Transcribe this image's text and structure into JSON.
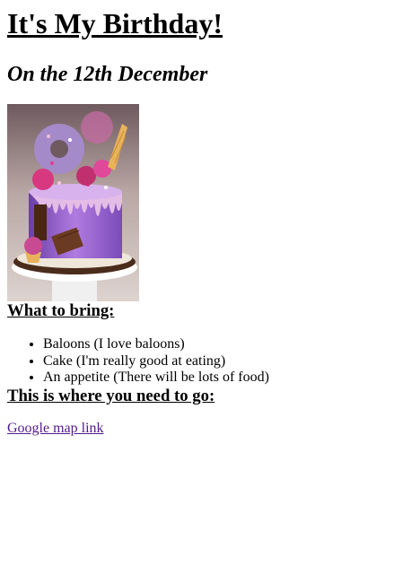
{
  "header": {
    "title": "It's My Birthday!",
    "subtitle": "On the 12th December"
  },
  "image": {
    "icon": "birthday-cake-photo",
    "colors": {
      "frosting": "#9b6fd0",
      "drip": "#e4bde6",
      "donut": "#a58ac9",
      "cone": "#e9b35a",
      "chocolate": "#6b3a22",
      "plate": "#f3f3f3",
      "board": "#4a2c1c"
    }
  },
  "bring": {
    "heading": "What to bring:",
    "items": [
      "Baloons (I love baloons)",
      "Cake (I'm really good at eating)",
      "An appetite (There will be lots of food)"
    ]
  },
  "location": {
    "heading": "This is where you need to go:",
    "link_label": "Google map link",
    "link_color": "#551a8b"
  }
}
